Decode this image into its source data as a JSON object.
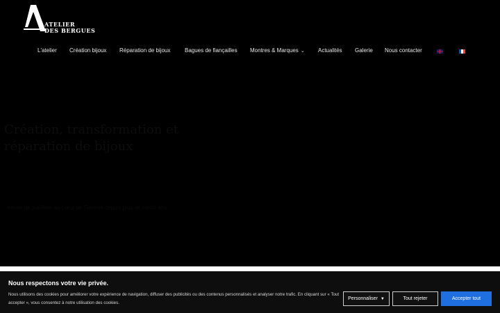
{
  "logo": {
    "line1": "ATELIER",
    "line2": "DES BERGUES"
  },
  "nav": [
    {
      "label": "L'atelier"
    },
    {
      "label": "Création bijoux"
    },
    {
      "label": "Réparation de bijoux"
    },
    {
      "label": "Bagues de fiançailles"
    },
    {
      "label": "Montres & Marques",
      "has_dropdown": true
    },
    {
      "label": "Actualités"
    },
    {
      "label": "Galerie"
    },
    {
      "label": "Nous contacter"
    }
  ],
  "languages": [
    {
      "code": "en",
      "icon": "uk-flag-icon"
    },
    {
      "code": "fr",
      "icon": "fr-flag-icon"
    }
  ],
  "hero": {
    "title": "Création, transformation et réparation de bijoux",
    "subtitle": "Atelier de joaillerie au cœur de Genève depuis plus de trente ans"
  },
  "cookie_banner": {
    "title": "Nous respectons votre vie privée.",
    "text": "Nous utilisons des cookies pour améliorer votre expérience de navigation, diffuser des publicités ou des contenus personnalisés et analyser notre trafic. En cliquant sur « Tout accepter », vous consentez à notre utilisation des cookies.",
    "customize_label": "Personnaliser",
    "reject_label": "Tout rejeter",
    "accept_label": "Accepter tout"
  },
  "colors": {
    "background": "#000000",
    "accept_button": "#1f6fe0",
    "banner": "#0e0e0e"
  }
}
